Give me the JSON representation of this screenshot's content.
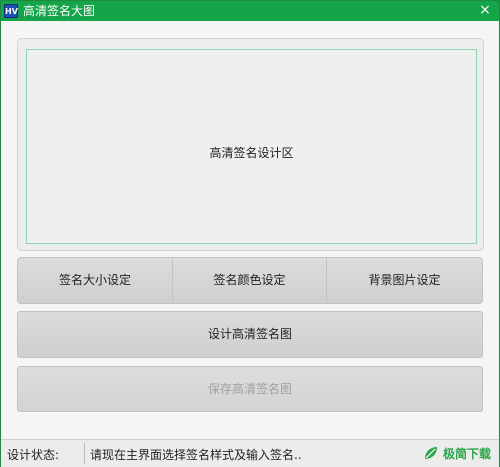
{
  "window": {
    "title": "高清签名大图",
    "app_icon_text": "HV",
    "close_symbol": "×"
  },
  "design_area": {
    "label": "高清签名设计区"
  },
  "buttons": {
    "size": "签名大小设定",
    "color": "签名颜色设定",
    "background": "背景图片设定",
    "design": "设计高清签名图",
    "save": "保存高清签名图"
  },
  "status": {
    "label": "设计状态:",
    "message": "请现在主界面选择签名样式及输入签名.."
  },
  "watermark": {
    "icon": "leaf-logo-icon",
    "text": "极简下载"
  }
}
